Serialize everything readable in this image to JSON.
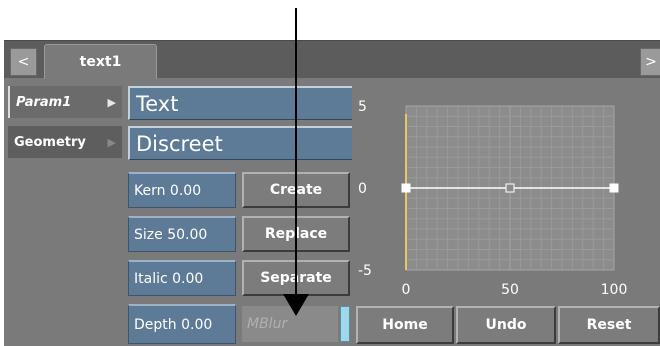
{
  "tab": {
    "prev_icon": "chevron-left-icon",
    "next_icon": "chevron-right-icon",
    "label": "text1",
    "prev_glyph": "<",
    "next_glyph": ">"
  },
  "sidebar": {
    "items": [
      {
        "label": "Param1",
        "active": true
      },
      {
        "label": "Geometry",
        "active": false
      }
    ]
  },
  "fields": {
    "text": "Text",
    "font": "Discreet"
  },
  "params": {
    "kern": "Kern 0.00",
    "size": "Size 50.00",
    "italic": "Italic 0.00",
    "depth": "Depth 0.00"
  },
  "buttons": {
    "create": "Create",
    "replace": "Replace",
    "separate": "Separate",
    "mblur": "MBlur",
    "home": "Home",
    "undo": "Undo",
    "reset": "Reset"
  },
  "graph": {
    "y_labels": [
      "5",
      "0",
      "-5"
    ],
    "x_labels": [
      "0",
      "50",
      "100"
    ]
  },
  "chart_data": {
    "type": "line",
    "x": [
      0,
      50,
      100
    ],
    "y": [
      0,
      0,
      0
    ],
    "xlim": [
      0,
      100
    ],
    "ylim": [
      -5,
      5
    ],
    "grid": true
  },
  "colors": {
    "panel": "#7a7a7a",
    "field_blue": "#5d7a96",
    "cursor_line": "#e8c66a",
    "mblur_indicator": "#9fd8ec"
  }
}
